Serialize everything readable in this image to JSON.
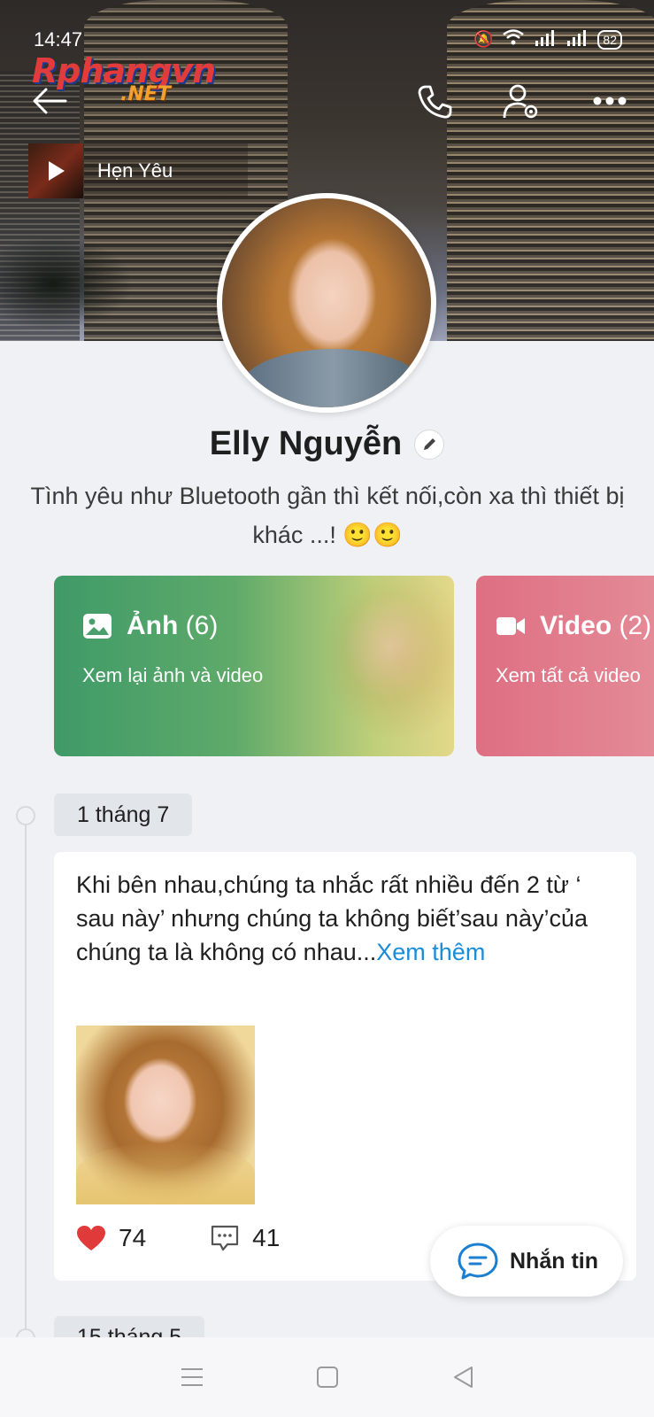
{
  "status_bar": {
    "time": "14:47",
    "battery": "82"
  },
  "watermark": {
    "main": "Rphangvn",
    "sub": ".NET"
  },
  "music": {
    "title": "Hẹn Yêu"
  },
  "profile": {
    "name": "Elly Nguyễn",
    "bio": "Tình yêu như Bluetooth gần thì kết nối,còn xa thì thiết bị khác ...! 🙂🙂"
  },
  "media_cards": [
    {
      "title": "Ảnh",
      "count": "(6)",
      "subtitle": "Xem lại ảnh và video",
      "color": "#3f9a68"
    },
    {
      "title": "Video",
      "count": "(2)",
      "subtitle": "Xem tất cả video",
      "color": "#de6f82"
    }
  ],
  "timeline": {
    "date": "1 tháng 7",
    "post": {
      "text": "Khi bên nhau,chúng ta nhắc rất nhiều đến 2 từ ‘ sau này’ nhưng chúng ta không biết’sau này’của chúng ta là không có nhau...",
      "see_more": "Xem thêm",
      "likes": "74",
      "comments": "41"
    },
    "next_date": "15 tháng 5"
  },
  "message_button": {
    "label": "Nhắn tin"
  },
  "accent_colors": {
    "link": "#1a8cd8",
    "like": "#e03a3a",
    "photo_card": "#3f9a68",
    "video_card": "#de6f82"
  },
  "icons": [
    "back-arrow-icon",
    "phone-icon",
    "person-settings-icon",
    "more-icon",
    "play-icon",
    "pencil-icon",
    "image-icon",
    "video-camera-icon",
    "heart-icon",
    "comment-icon",
    "chat-bubble-icon",
    "menu-icon",
    "home-square-icon",
    "back-triangle-icon"
  ]
}
